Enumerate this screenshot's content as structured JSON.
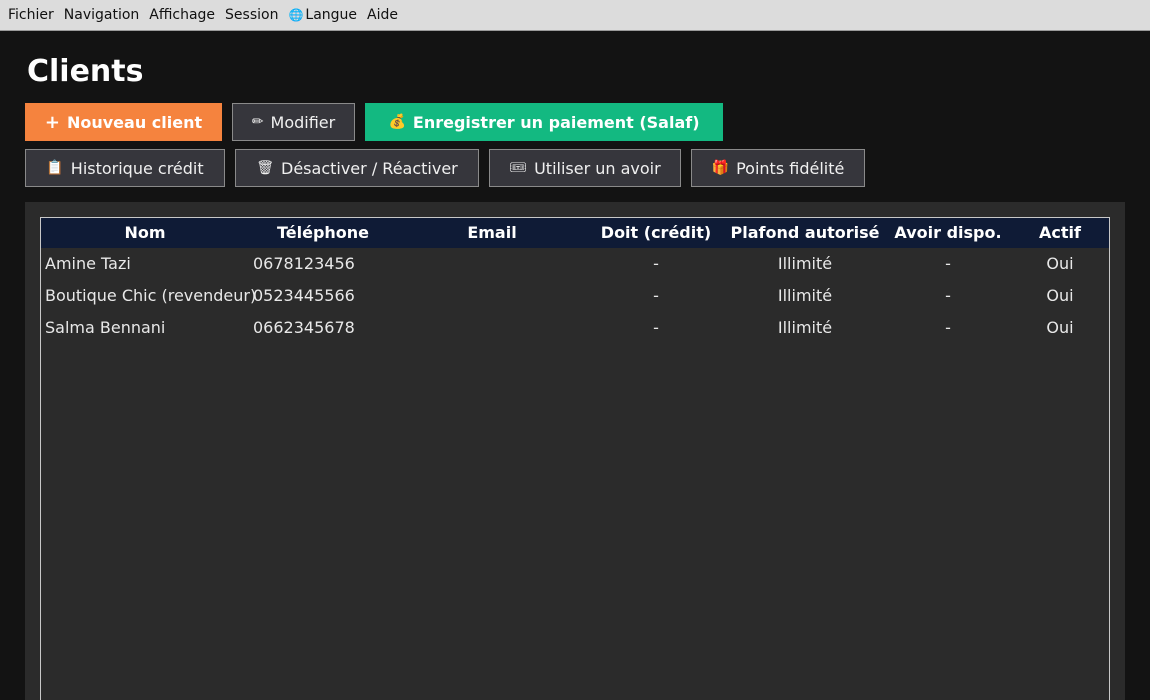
{
  "menu": {
    "items": [
      {
        "label": "Fichier",
        "icon": ""
      },
      {
        "label": "Navigation",
        "icon": ""
      },
      {
        "label": "Affichage",
        "icon": ""
      },
      {
        "label": "Session",
        "icon": ""
      },
      {
        "label": "Langue",
        "icon": "globe-icon"
      },
      {
        "label": "Aide",
        "icon": ""
      }
    ]
  },
  "page": {
    "title": "Clients"
  },
  "toolbar": {
    "new_client": "Nouveau client",
    "edit": "Modifier",
    "record_payment": "Enregistrer un paiement (Salaf)",
    "credit_history": "Historique crédit",
    "toggle_active": "Désactiver / Réactiver",
    "use_credit_note": "Utiliser un avoir",
    "loyalty_points": "Points fidélité"
  },
  "colors": {
    "primary": "#f5833e",
    "success": "#13b981",
    "table_header": "#0f1b36",
    "background": "#131313",
    "panel": "#2b2b2b"
  },
  "table": {
    "columns": [
      "Nom",
      "Téléphone",
      "Email",
      "Doit (crédit)",
      "Plafond autorisé",
      "Avoir dispo.",
      "Actif"
    ],
    "rows": [
      {
        "nom": "Amine Tazi",
        "telephone": "0678123456",
        "email": "",
        "doit": "-",
        "plafond": "Illimité",
        "avoir": "-",
        "actif": "Oui"
      },
      {
        "nom": "Boutique Chic (revendeur)",
        "telephone": "0523445566",
        "email": "",
        "doit": "-",
        "plafond": "Illimité",
        "avoir": "-",
        "actif": "Oui"
      },
      {
        "nom": "Salma Bennani",
        "telephone": "0662345678",
        "email": "",
        "doit": "-",
        "plafond": "Illimité",
        "avoir": "-",
        "actif": "Oui"
      }
    ]
  }
}
